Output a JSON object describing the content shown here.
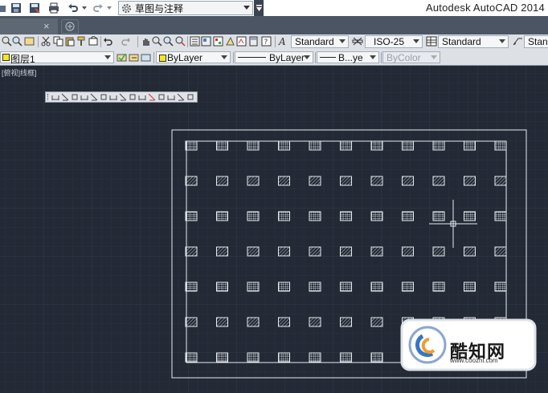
{
  "app": {
    "title": "Autodesk AutoCAD 2014"
  },
  "quick_access": {
    "workspace_label": "草图与注释"
  },
  "tabs": {
    "close_glyph": "×"
  },
  "styles_toolbar": {
    "text_style": "Standard",
    "dim_style": "ISO-25",
    "table_style": "Standard",
    "multileader_style": "Standa"
  },
  "layer_toolbar": {
    "layer_name": "图层1"
  },
  "properties_toolbar": {
    "color": "ByLayer",
    "linetype": "ByLayer",
    "lineweight": "B...ye",
    "plot_style": "ByColor"
  },
  "viewport": {
    "label": "[俯视]线框]"
  },
  "watermark": {
    "name": "酷知网",
    "url": "www.coozhi.com"
  },
  "colors": {
    "canvas": "#232a36",
    "grid": "#2d3543",
    "entity": "#e8ecf0",
    "toolbar": "#dde1e6"
  }
}
